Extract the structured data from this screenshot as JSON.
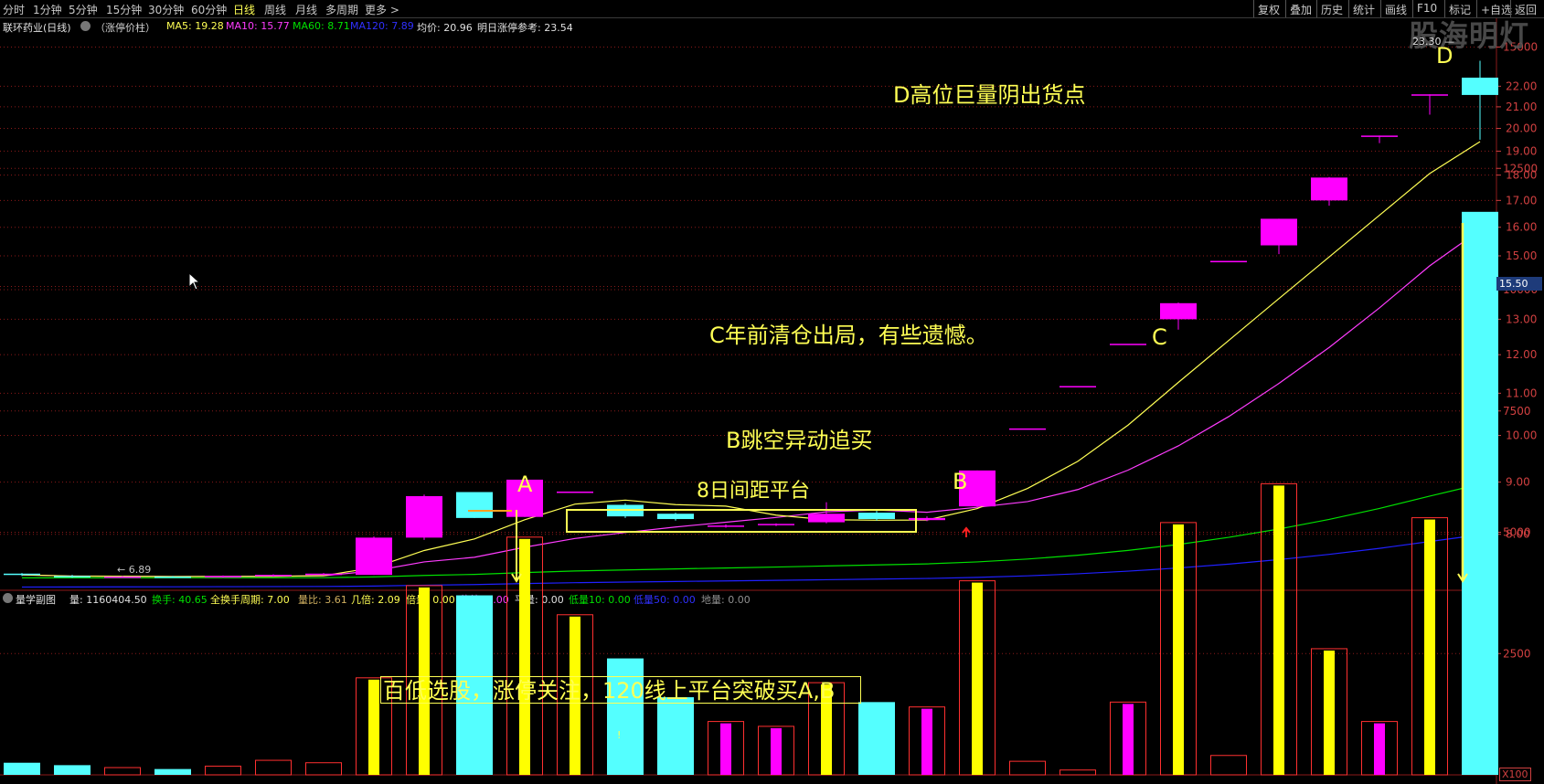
{
  "toolbar": {
    "periods": [
      {
        "label": "分时",
        "active": false
      },
      {
        "label": "1分钟",
        "active": false
      },
      {
        "label": "5分钟",
        "active": false
      },
      {
        "label": "15分钟",
        "active": false
      },
      {
        "label": "30分钟",
        "active": false
      },
      {
        "label": "60分钟",
        "active": false
      },
      {
        "label": "日线",
        "active": true
      },
      {
        "label": "周线",
        "active": false
      },
      {
        "label": "月线",
        "active": false
      },
      {
        "label": "多周期",
        "active": false
      },
      {
        "label": "更多 >",
        "active": false
      }
    ],
    "right": [
      "复权",
      "叠加",
      "历史",
      "统计",
      "画线",
      "F10",
      "标记",
      "+自选",
      "返回"
    ]
  },
  "info": {
    "stock": "联环药业(日线)",
    "indicator": "（涨停价柱）",
    "ma5": "MA5: 19.28",
    "ma10": "MA10: 15.77",
    "ma60": "MA60: 8.71",
    "ma120": "MA120: 7.89",
    "avg": "均价: 20.96",
    "limit": "明日涨停参考: 23.54"
  },
  "volinfo": {
    "title": "量学副图",
    "vol": "量: 1160404.50",
    "turnover": "换手: 40.65",
    "cycle": "全换手周期: 7.00",
    "ratio": "量比: 3.61",
    "times": "几倍: 2.09",
    "double": "倍量: 0.00",
    "shrink": "倍缩: 0.00",
    "flat": "平量: 0.00",
    "low10": "低量10: 0.00",
    "low50": "低量50: 0.00",
    "ground": "地量: 0.00"
  },
  "watermark": "股海明灯",
  "annotations": {
    "A": "A",
    "B": "B",
    "C": "C",
    "D": "D",
    "d_note": "D高位巨量阴出货点",
    "c_note": "C年前清仓出局，有些遗憾。",
    "b_note": "B跳空异动追买",
    "platform": "8日间距平台",
    "strategy": "百低选股，涨停关注，120线上平台突破买A,B",
    "high_label": "23.30 —",
    "low_label": "← 6.89",
    "price_tag": "15.50",
    "vol_unit": "X100",
    "tiny_mark": "!"
  },
  "colors": {
    "up": "#ff00ff",
    "down": "#54ffff",
    "ma5": "#ffff54",
    "ma10": "#ff3cff",
    "ma60": "#00e000",
    "ma120": "#2020ff",
    "axis": "#d04040",
    "annotation": "#ffff54"
  },
  "chart_data": {
    "type": "candlestick",
    "price_axis": {
      "ticks": [
        "8.00",
        "9.00",
        "10.00",
        "11.00",
        "12.00",
        "13.00",
        "14.00",
        "15.00",
        "16.00",
        "17.00",
        "18.00",
        "19.00",
        "20.00",
        "21.00",
        "22.00"
      ]
    },
    "volume_axis": {
      "ticks": [
        "2500",
        "5000",
        "7500",
        "10000",
        "12500",
        "15000"
      ]
    },
    "candles": [
      {
        "o": 7.32,
        "c": 7.3,
        "h": 7.33,
        "l": 7.28,
        "v": 250
      },
      {
        "o": 7.28,
        "c": 7.26,
        "h": 7.3,
        "l": 7.25,
        "v": 200
      },
      {
        "o": 7.26,
        "c": 7.27,
        "h": 7.28,
        "l": 7.25,
        "v": 150
      },
      {
        "o": 7.27,
        "c": 7.26,
        "h": 7.28,
        "l": 7.25,
        "v": 120
      },
      {
        "o": 7.26,
        "c": 7.28,
        "h": 7.29,
        "l": 7.25,
        "v": 180
      },
      {
        "o": 7.28,
        "c": 7.3,
        "h": 7.31,
        "l": 7.27,
        "v": 300
      },
      {
        "o": 7.3,
        "c": 7.32,
        "h": 7.33,
        "l": 7.29,
        "v": 250
      },
      {
        "o": 7.3,
        "c": 7.94,
        "h": 7.96,
        "l": 7.3,
        "v": 2000
      },
      {
        "o": 7.94,
        "c": 8.72,
        "h": 8.75,
        "l": 7.9,
        "v": 3900
      },
      {
        "o": 8.8,
        "c": 8.3,
        "h": 8.8,
        "l": 8.3,
        "v": 3700
      },
      {
        "o": 8.32,
        "c": 9.05,
        "h": 9.05,
        "l": 8.32,
        "v": 4900
      },
      {
        "o": 8.81,
        "c": 8.81,
        "h": 8.81,
        "l": 8.81,
        "v": 3300
      },
      {
        "o": 8.55,
        "c": 8.33,
        "h": 8.58,
        "l": 8.3,
        "v": 2400
      },
      {
        "o": 8.38,
        "c": 8.28,
        "h": 8.4,
        "l": 8.25,
        "v": 1600
      },
      {
        "o": 8.15,
        "c": 8.16,
        "h": 8.18,
        "l": 8.12,
        "v": 1100
      },
      {
        "o": 8.17,
        "c": 8.19,
        "h": 8.2,
        "l": 8.15,
        "v": 1000
      },
      {
        "o": 8.22,
        "c": 8.38,
        "h": 8.6,
        "l": 8.2,
        "v": 1900
      },
      {
        "o": 8.4,
        "c": 8.28,
        "h": 8.45,
        "l": 8.25,
        "v": 1500
      },
      {
        "o": 8.26,
        "c": 8.3,
        "h": 8.33,
        "l": 8.24,
        "v": 1400
      },
      {
        "o": 8.52,
        "c": 9.24,
        "h": 9.24,
        "l": 8.5,
        "v": 4000
      },
      {
        "o": 10.16,
        "c": 10.16,
        "h": 10.16,
        "l": 10.16,
        "v": 280
      },
      {
        "o": 11.18,
        "c": 11.18,
        "h": 11.18,
        "l": 11.18,
        "v": 100
      },
      {
        "o": 12.3,
        "c": 12.3,
        "h": 12.3,
        "l": 12.3,
        "v": 1500
      },
      {
        "o": 13.0,
        "c": 13.48,
        "h": 13.5,
        "l": 12.7,
        "v": 5200
      },
      {
        "o": 14.83,
        "c": 14.83,
        "h": 14.83,
        "l": 14.83,
        "v": 400
      },
      {
        "o": 15.36,
        "c": 16.31,
        "h": 16.31,
        "l": 15.06,
        "v": 6000
      },
      {
        "o": 17.0,
        "c": 17.9,
        "h": 17.92,
        "l": 16.8,
        "v": 2600
      },
      {
        "o": 19.68,
        "c": 19.68,
        "h": 19.68,
        "l": 19.35,
        "v": 1100
      },
      {
        "o": 21.6,
        "c": 21.6,
        "h": 21.6,
        "l": 20.63,
        "v": 5300
      },
      {
        "o": 22.43,
        "c": 21.57,
        "h": 23.3,
        "l": 19.5,
        "v": 11604
      }
    ]
  }
}
